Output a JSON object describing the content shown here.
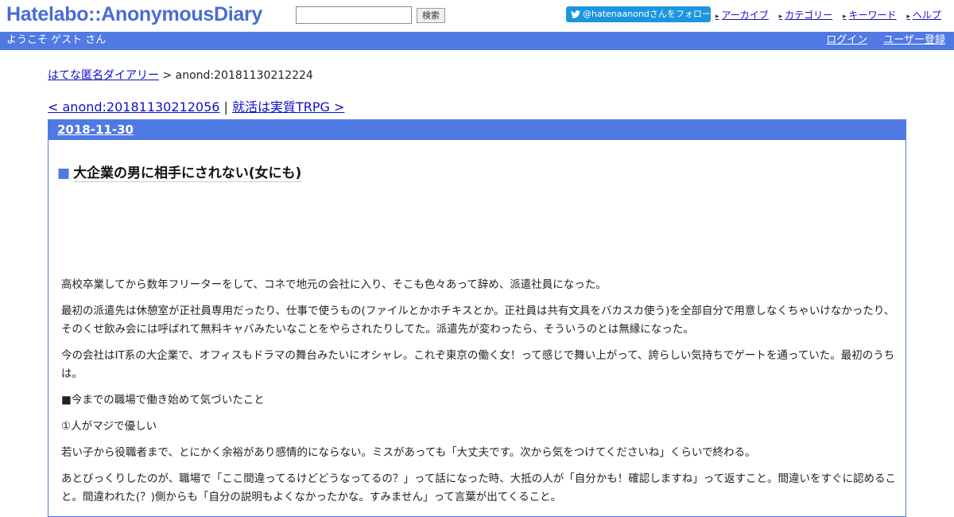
{
  "header": {
    "logo": "Hatelabo::AnonymousDiary",
    "search_button": "検索",
    "follow_label": "@hatenaanondさんをフォロー",
    "links": [
      "アーカイブ",
      "カテゴリー",
      "キーワード",
      "ヘルプ"
    ]
  },
  "bar": {
    "welcome": "ようこそ ゲスト さん",
    "login": "ログイン",
    "register": "ユーザー登録"
  },
  "breadcrumb": {
    "home": "はてな匿名ダイアリー",
    "separator": " > ",
    "current": "anond:20181130212224"
  },
  "pagenav": {
    "prev": "< anond:20181130212056",
    "separator": " | ",
    "next": "就活は実質TRPG >"
  },
  "day": {
    "date": "2018-11-30",
    "marker": "■",
    "title": "大企業の男に相手にされない(女にも)"
  },
  "paragraphs": [
    "高校卒業してから数年フリーターをして、コネで地元の会社に入り、そこも色々あって辞め、派遣社員になった。",
    "最初の派遣先は休憩室が正社員専用だったり、仕事で使うもの(ファイルとかホチキスとか。正社員は共有文具をバカスカ使う)を全部自分で用意しなくちゃいけなかったり、そのくせ飲み会には呼ばれて無料キャバみたいなことをやらされたりしてた。派遣先が変わったら、そういうのとは無縁になった。",
    "今の会社はIT系の大企業で、オフィスもドラマの舞台みたいにオシャレ。これぞ東京の働く女！って感じで舞い上がって、誇らしい気持ちでゲートを通っていた。最初のうちは。",
    "■今までの職場で働き始めて気づいたこと",
    "①人がマジで優しい",
    "若い子から役職者まで、とにかく余裕があり感情的にならない。ミスがあっても「大丈夫です。次から気をつけてくださいね」くらいで終わる。",
    "あとびっくりしたのが、職場で「ここ間違ってるけどどうなってるの？」って話になった時、大抵の人が「自分かも！確認しますね」って返すこと。間違いをすぐに認めること。間違われた(？)側からも「自分の説明もよくなかったかな。すみません」って言葉が出てくること。"
  ],
  "colors": {
    "accent": "#5079e4",
    "link": "#1010c8",
    "twitter": "#1b95e0"
  }
}
